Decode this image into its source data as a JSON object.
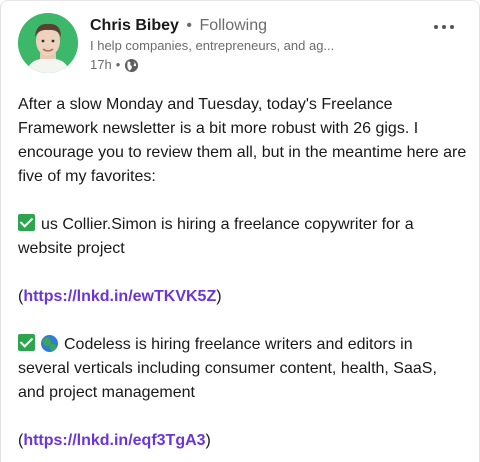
{
  "author": {
    "name": "Chris Bibey",
    "separator": "•",
    "follow_status": "Following",
    "headline": "I help companies, entrepreneurs, and ag...",
    "time": "17h",
    "time_separator": "•",
    "visibility_icon": "globe-icon"
  },
  "menu_icon": "more-options-icon",
  "post": {
    "intro": "After a slow Monday and Tuesday, today's Freelance Framework newsletter is a bit more robust with 26 gigs. I encourage you to review them all, but in the meantime here are five of my favorites:",
    "item1_text": "us Collier.Simon is hiring a freelance copywriter for a website project",
    "item1_link": "https://lnkd.in/ewTKVK5Z",
    "item2_text": "Codeless is hiring freelance writers and editors in several verticals including consumer content, health, SaaS, and project management",
    "item2_link": "https://lnkd.in/eqf3TgA3",
    "paren_open": "(",
    "paren_close": ")"
  },
  "colors": {
    "avatar_bg": "#3db86a",
    "link": "#6a35d9",
    "check_bg": "#2ea44f",
    "muted": "#6b6b6b"
  }
}
